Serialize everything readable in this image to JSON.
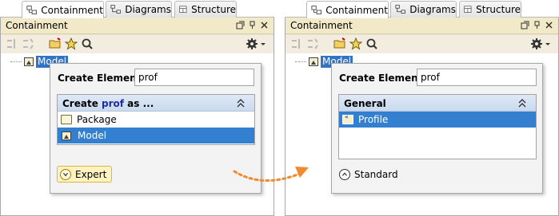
{
  "tabs": [
    {
      "label": "Containment"
    },
    {
      "label": "Diagrams"
    },
    {
      "label": "Structure"
    }
  ],
  "panel": {
    "title": "Containment",
    "tree_item": "Model"
  },
  "left_popup": {
    "create_label": "Create Element:",
    "input_value": "prof",
    "header_prefix": "Create ",
    "header_highlight": "prof",
    "header_suffix": " as ...",
    "items": [
      "Package",
      "Model"
    ],
    "mode_button": "Expert"
  },
  "right_popup": {
    "create_label": "Create Element:",
    "input_value": "prof",
    "group_header": "General",
    "items": [
      "Profile"
    ],
    "mode_button": "Standard"
  },
  "colors": {
    "selection": "#3380d0",
    "panel_title_bg": "#f2e9c9",
    "arrow": "#f08a30",
    "expert_bg": "#fff3c2"
  }
}
